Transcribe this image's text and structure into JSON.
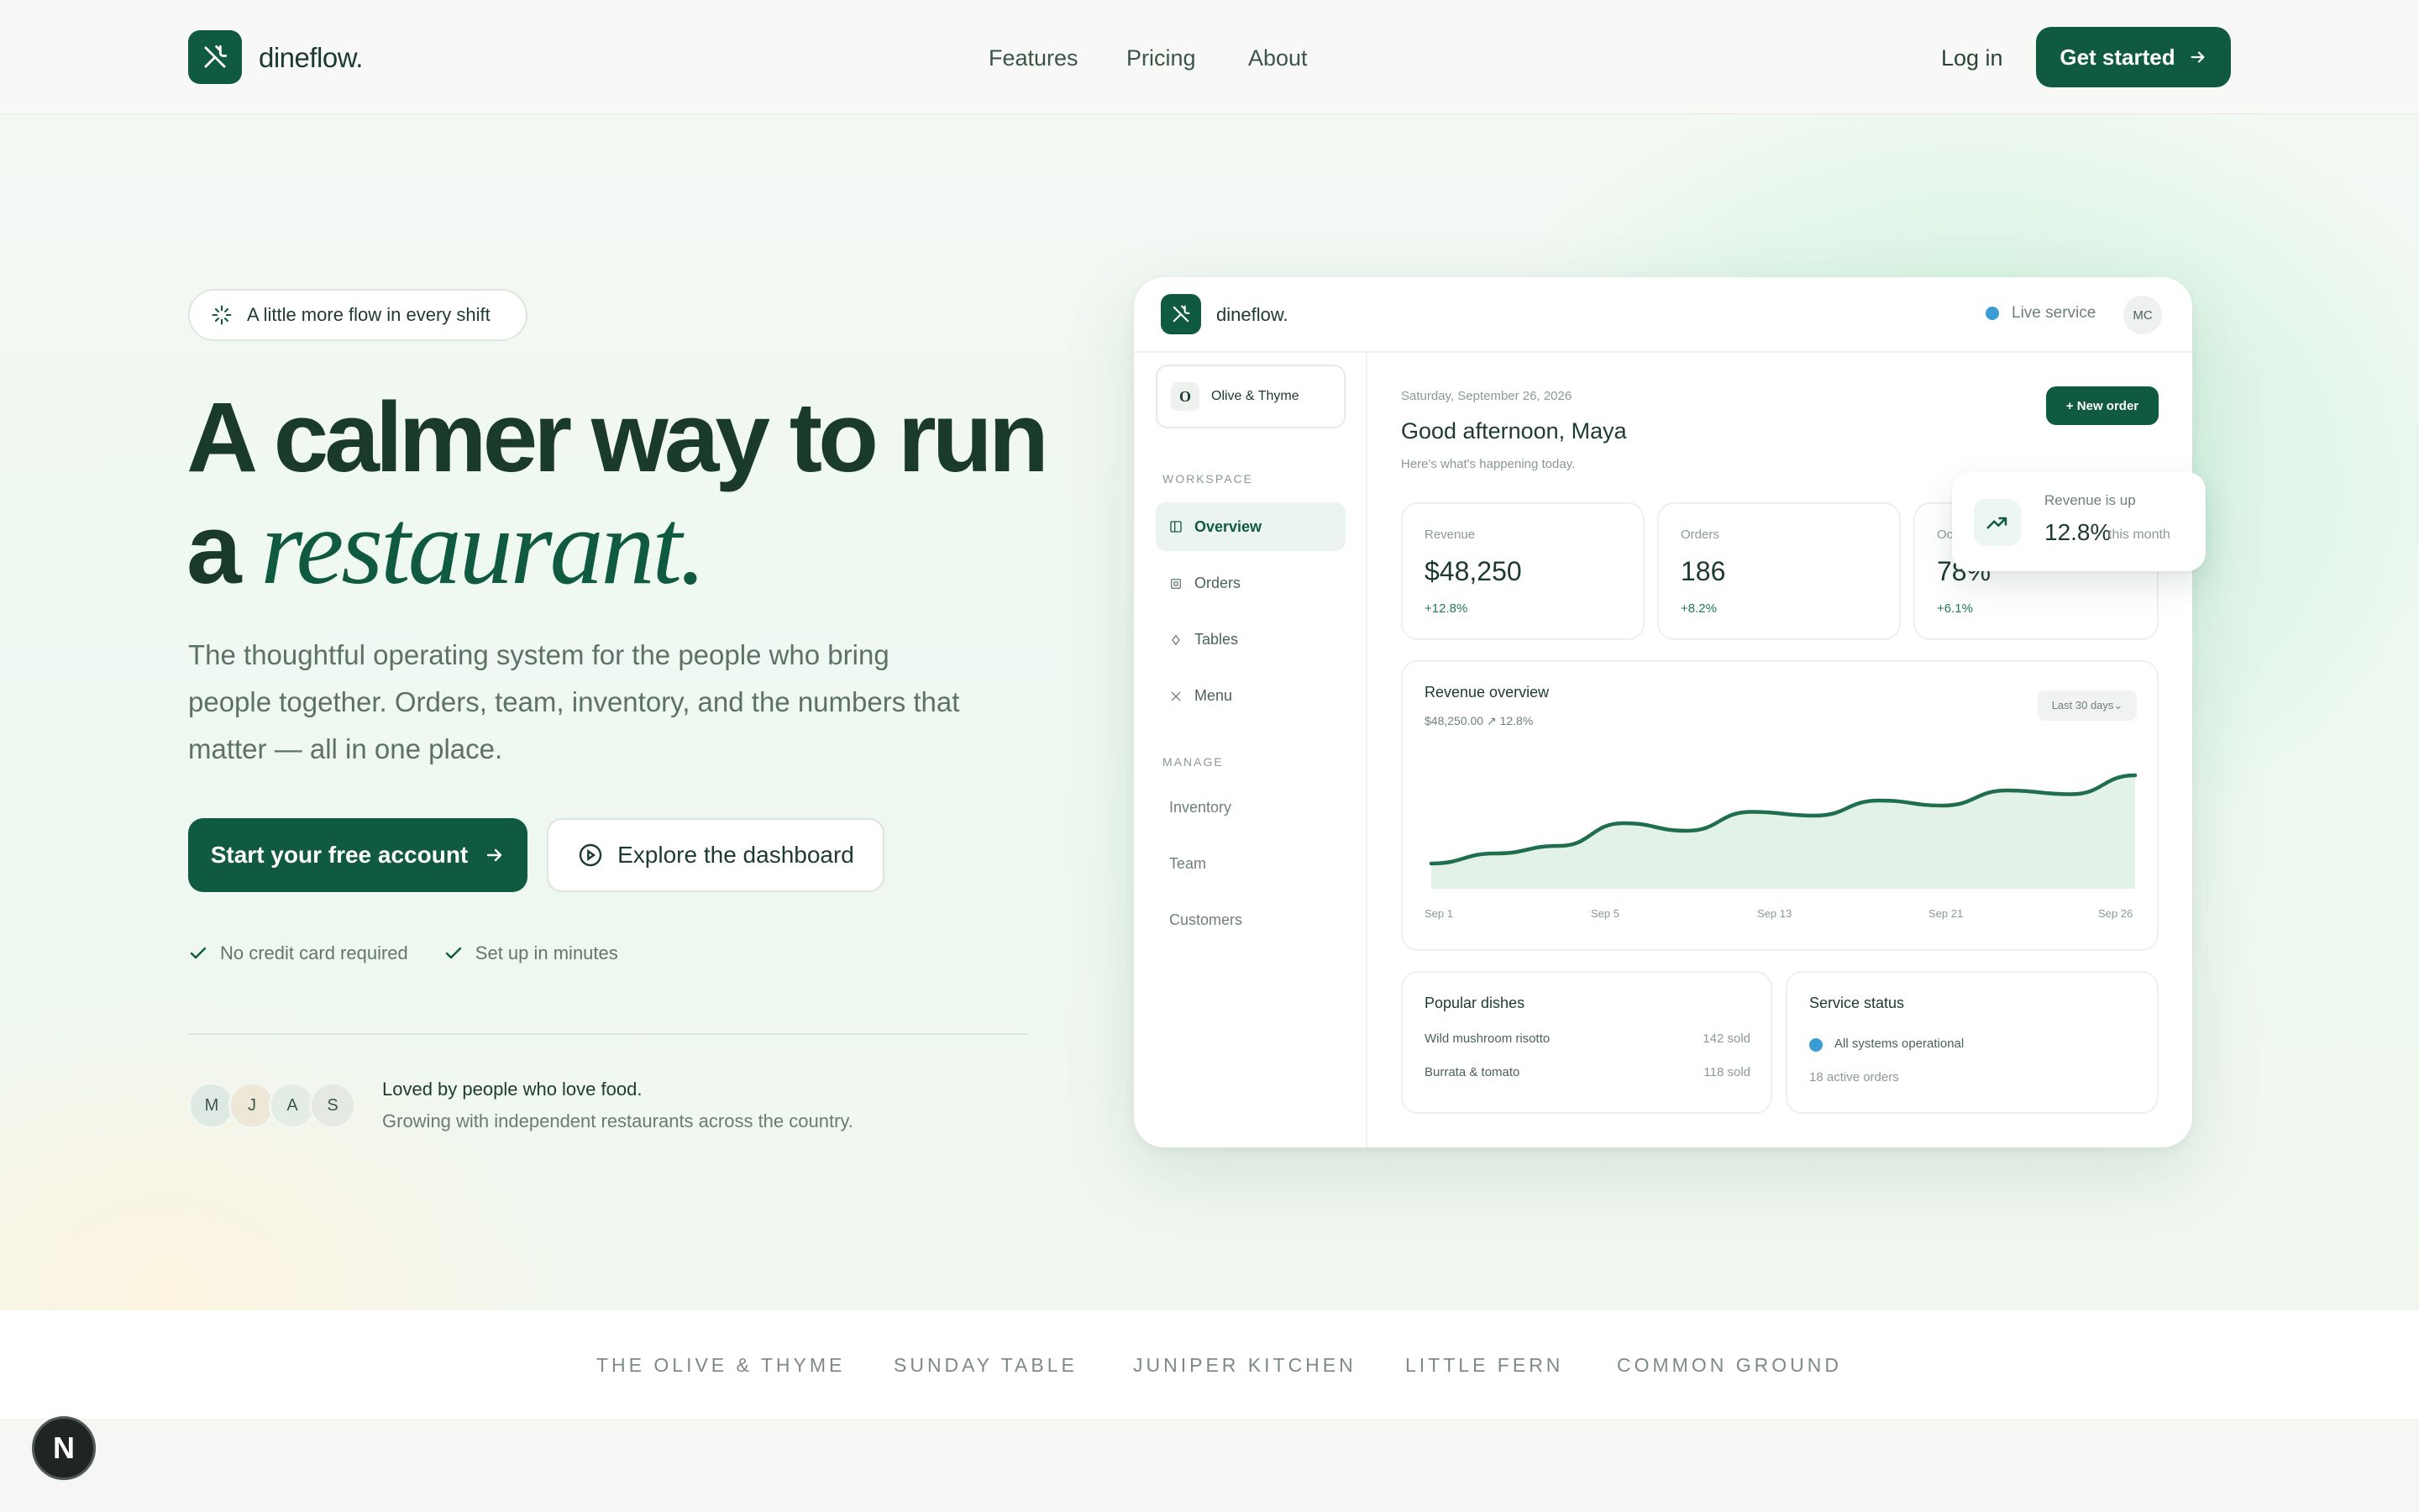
{
  "nav": {
    "brand": "dineflow.",
    "links": [
      "Features",
      "Pricing",
      "About"
    ],
    "login": "Log in",
    "cta": "Get started"
  },
  "hero": {
    "pill": "A little more flow in every shift",
    "title_line1": "A calmer way to run",
    "title_line2_prefix": "a ",
    "title_line2_emph": "restaurant.",
    "lead": "The thoughtful operating system for the people who bring people together. Orders, team, inventory, and the numbers that matter — all in one place.",
    "primary_cta": "Start your free account",
    "secondary_cta": "Explore the dashboard",
    "checks": [
      "No credit card required",
      "Set up in minutes"
    ],
    "social_title": "Loved by people who love food.",
    "social_sub": "Growing with independent restaurants across the country.",
    "avatars": [
      "M",
      "J",
      "A",
      "S"
    ]
  },
  "dashboard": {
    "brand": "dineflow.",
    "live": "Live service",
    "user_initials": "MC",
    "venue": "Olive & Thyme",
    "venue_initial": "O",
    "workspace_label": "WORKSPACE",
    "workspace_items": [
      "Overview",
      "Orders",
      "Tables",
      "Menu"
    ],
    "manage_label": "MANAGE",
    "manage_items": [
      "Inventory",
      "Team",
      "Customers"
    ],
    "date": "Saturday, September 26, 2026",
    "greeting": "Good afternoon, Maya",
    "subgreeting": "Here's what's happening today.",
    "new_order": "+ New order",
    "stats": [
      {
        "label": "Revenue",
        "value": "$48,250",
        "delta": "+12.8%"
      },
      {
        "label": "Orders",
        "value": "186",
        "delta": "+8.2%"
      },
      {
        "label": "Oc",
        "value": "78%",
        "delta": "+6.1%"
      }
    ],
    "floating": {
      "title": "Revenue is up",
      "value": "12.8%",
      "suffix": "this month"
    },
    "revenue": {
      "title": "Revenue overview",
      "summary": "$48,250.00 ↗ 12.8%",
      "range": "Last 30 days⌄"
    },
    "popular": {
      "title": "Popular dishes",
      "items": [
        {
          "name": "Wild mushroom risotto",
          "sold": "142 sold"
        },
        {
          "name": "Burrata & tomato",
          "sold": "118 sold"
        }
      ]
    },
    "service": {
      "title": "Service status",
      "status": "All systems operational",
      "orders": "18 active orders"
    }
  },
  "chart_data": {
    "type": "area",
    "x": [
      "Sep 1",
      "Sep 5",
      "Sep 13",
      "Sep 21",
      "Sep 26"
    ],
    "values": [
      20,
      28,
      34,
      52,
      46,
      61,
      58,
      70,
      66,
      78,
      75,
      90
    ],
    "title": "Revenue overview",
    "xlabel": "",
    "ylabel": "",
    "grid": false
  },
  "brands_strip": [
    "THE OLIVE & THYME",
    "SUNDAY TABLE",
    "JUNIPER KITCHEN",
    "LITTLE FERN",
    "COMMON GROUND"
  ],
  "colors": {
    "accent": "#0f5a40",
    "live_dot": "#3a9bd5",
    "chart_fill": "#e3f2e9"
  },
  "dev_badge": "N"
}
